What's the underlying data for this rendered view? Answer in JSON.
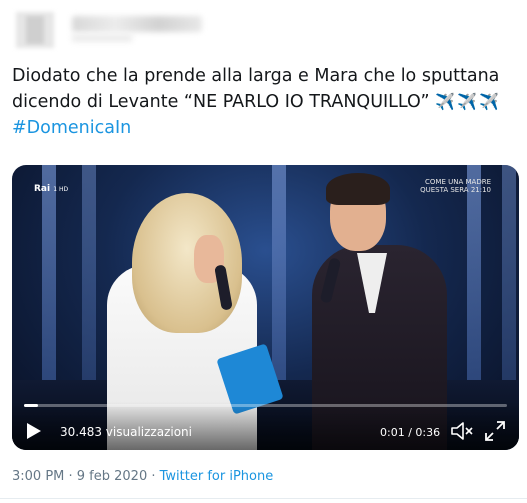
{
  "tweet": {
    "text_main": "Diodato che la prende alla larga e Mara che lo sputtana dicendo di Levante “NE PARLO IO TRANQUILLO”",
    "emojis": "✈️✈️✈️",
    "hashtag": "#DomenicaIn"
  },
  "video": {
    "channel_logo": "Rai",
    "channel_hd": "1 HD",
    "promo_line1": "COME UNA MADRE",
    "promo_line2": "QUESTA SERA 21:10",
    "views": "30.483 visualizzazioni",
    "time": "0:01 / 0:36",
    "progress": 0.03
  },
  "meta": {
    "timestamp": "3:00 PM · 9 feb 2020",
    "separator": " · ",
    "source": "Twitter for iPhone"
  },
  "colors": {
    "link": "#1b95e0",
    "muted": "#657786",
    "text": "#14171a"
  }
}
